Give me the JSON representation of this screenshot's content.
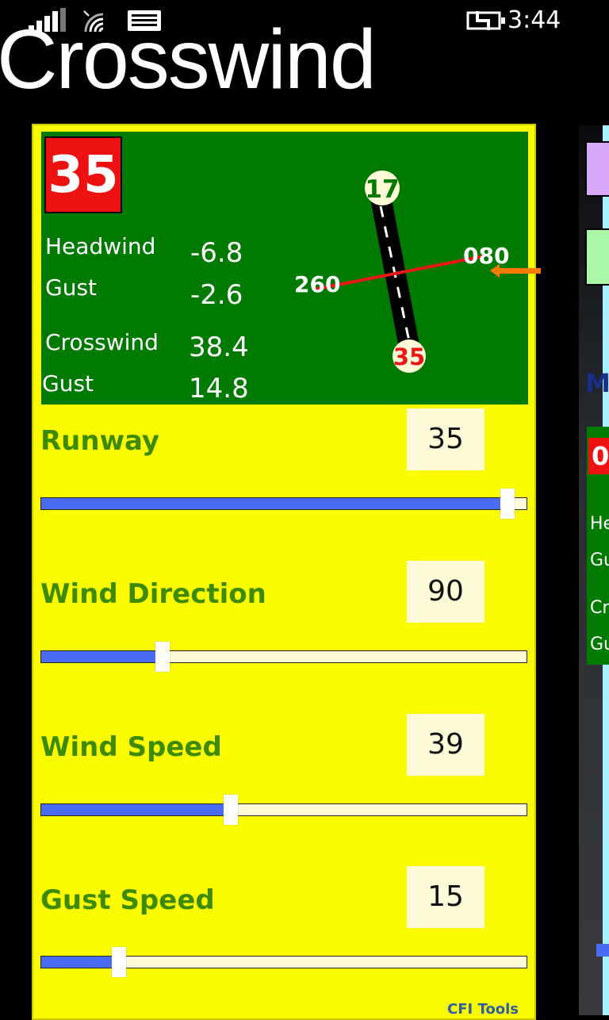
{
  "status_bar": {
    "time": "3:44"
  },
  "app": {
    "title": "Crosswind"
  },
  "summary": {
    "runway": "35",
    "headwind_label": "Headwind",
    "headwind_value": "-6.8",
    "head_gust_label": "Gust",
    "head_gust_value": "-2.6",
    "crosswind_label": "Crosswind",
    "crosswind_value": "38.4",
    "cross_gust_label": "Gust",
    "cross_gust_value": "14.8"
  },
  "diagram": {
    "runway_top_label": "17",
    "runway_bottom_label": "35",
    "wind_from_label": "080",
    "wind_to_label": "260"
  },
  "controls": [
    {
      "label": "Runway",
      "value": "35",
      "position": 0.96
    },
    {
      "label": "Wind Direction",
      "value": "90",
      "position": 0.25
    },
    {
      "label": "Wind Speed",
      "value": "39",
      "position": 0.39
    },
    {
      "label": "Gust Speed",
      "value": "15",
      "position": 0.16
    }
  ],
  "footer": {
    "brand": "CFI Tools"
  },
  "colors": {
    "card_bg": "#fcfc00",
    "summary_bg": "#007a00",
    "badge_red": "#ee1111",
    "label_green": "#3e8a00",
    "slider_fill": "#4a6cf2"
  },
  "next_panel": {
    "title_fragment": "M",
    "badge_fragment": "0",
    "rows": [
      "He",
      "Gu",
      "Cr",
      "Gu"
    ]
  }
}
